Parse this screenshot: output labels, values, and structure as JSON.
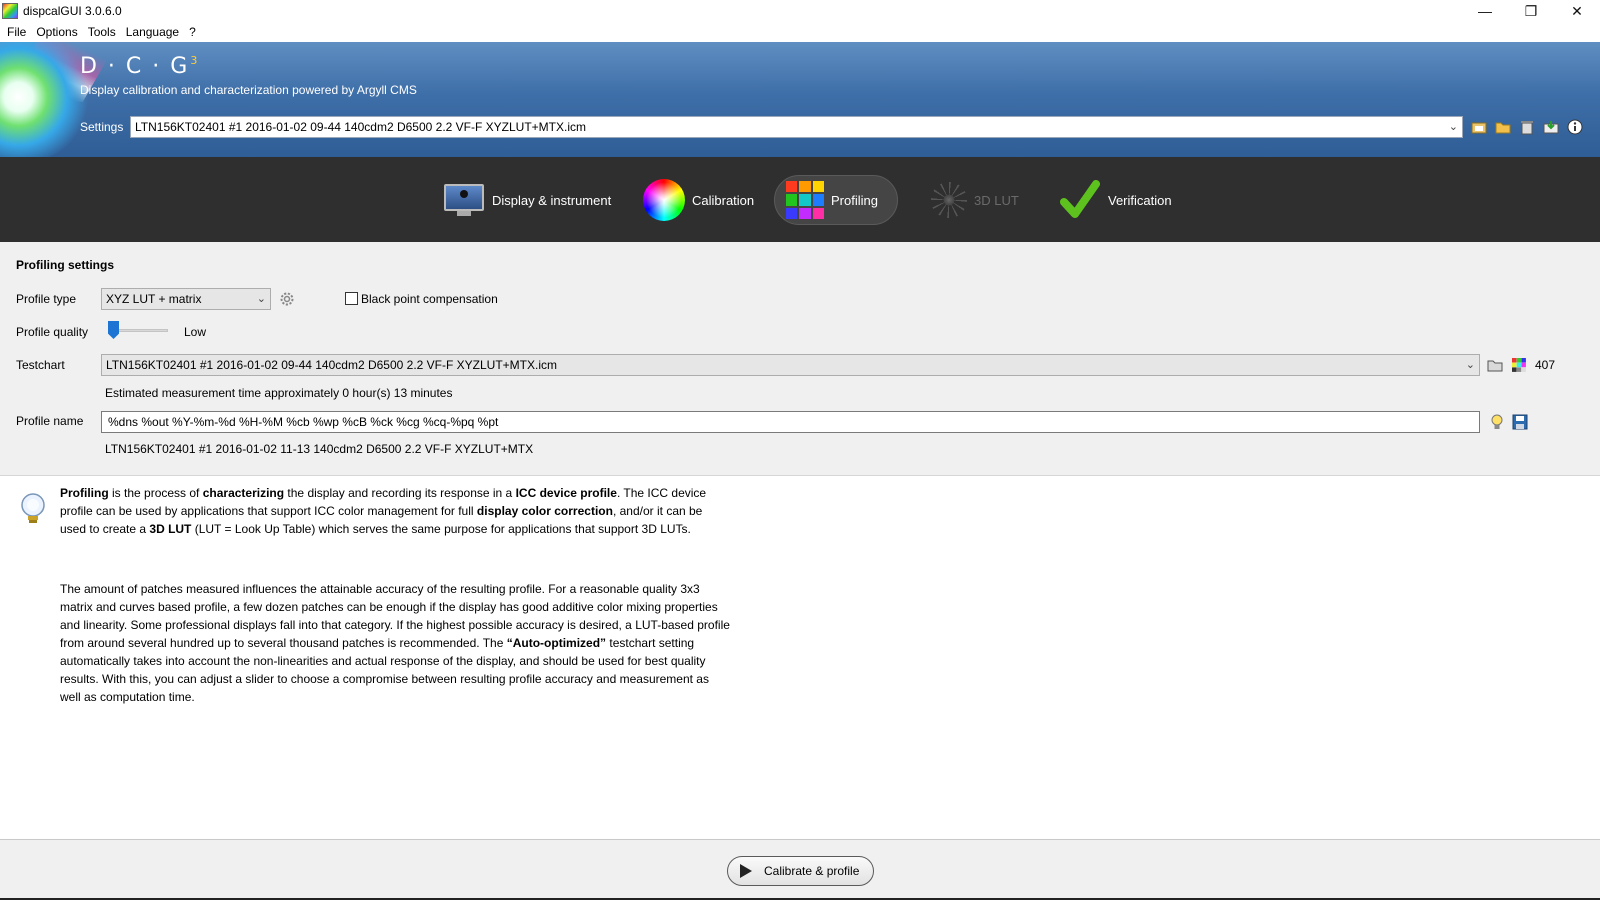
{
  "window": {
    "title": "dispcalGUI 3.0.6.0",
    "controls": {
      "minimize": "—",
      "restore": "❐",
      "close": "✕"
    }
  },
  "menu": [
    "File",
    "Options",
    "Tools",
    "Language",
    "?"
  ],
  "header": {
    "logo": "D · C · G",
    "logo_version": "3",
    "subtitle": "Display calibration and characterization powered by Argyll CMS",
    "settings_label": "Settings",
    "settings_value": "LTN156KT02401 #1 2016-01-02 09-44 140cdm2 D6500 2.2 VF-F XYZLUT+MTX.icm",
    "icons": [
      "load-settings-icon",
      "open-folder-icon",
      "delete-icon",
      "install-profile-icon",
      "info-icon"
    ]
  },
  "tabs": [
    {
      "label": "Display & instrument",
      "icon": "monitor-icon",
      "state": "normal"
    },
    {
      "label": "Calibration",
      "icon": "color-wheel-icon",
      "state": "normal"
    },
    {
      "label": "Profiling",
      "icon": "color-grid-icon",
      "state": "active"
    },
    {
      "label": "3D LUT",
      "icon": "lut-icon",
      "state": "disabled"
    },
    {
      "label": "Verification",
      "icon": "checkmark-icon",
      "state": "normal"
    }
  ],
  "profiling": {
    "section_title": "Profiling settings",
    "profile_type_label": "Profile type",
    "profile_type_value": "XYZ LUT + matrix",
    "bpc_label": "Black point compensation",
    "bpc_checked": false,
    "quality_label": "Profile quality",
    "quality_value": "Low",
    "quality_level": 0.0,
    "testchart_label": "Testchart",
    "testchart_value": "LTN156KT02401 #1 2016-01-02 09-44 140cdm2 D6500 2.2 VF-F XYZLUT+MTX.icm",
    "patch_count": "407",
    "estimated_time": "Estimated measurement time approximately 0 hour(s) 13 minutes",
    "profile_name_label": "Profile name",
    "profile_name_value": "%dns %out %Y-%m-%d %H-%M %cb %wp %cB %ck %cg %cq-%pq %pt",
    "profile_name_preview": "LTN156KT02401 #1 2016-01-02 11-13 140cdm2 D6500 2.2 VF-F XYZLUT+MTX"
  },
  "info": {
    "p1": {
      "b1": "Profiling",
      "t1": " is the process of ",
      "b2": "characterizing",
      "t2": " the display and recording its response in a ",
      "b3": "ICC device profile",
      "t3": ". The ICC device profile can be used by applications that support ICC color management for full ",
      "b4": "display color correction",
      "t4": ", and/or it can be used to create a ",
      "b5": "3D LUT",
      "t5": " (LUT = Look Up Table) which serves the same purpose for applications that support 3D LUTs."
    },
    "p2": {
      "t1": "The amount of patches measured influences the attainable accuracy of the resulting profile. For a reasonable quality 3x3 matrix and curves based profile, a few dozen patches can be enough if the display has good additive color mixing properties and linearity. Some professional displays fall into that category. If the highest possible accuracy is desired, a LUT-based profile from around several hundred up to several thousand patches is recommended. The ",
      "b1": "“Auto-optimized”",
      "t2": " testchart setting automatically takes into account the non-linearities and actual response of the display, and should be used for best quality results. With this, you can adjust a slider to choose a compromise between resulting profile accuracy and measurement as well as computation time."
    }
  },
  "action": {
    "label": "Calibrate & profile"
  },
  "colors": {
    "header_top": "#5f8ec2",
    "header_bottom": "#2f5d96",
    "tabstrip": "#2f2f2f",
    "accent": "#1e74d2",
    "check": "#5ec21e"
  }
}
